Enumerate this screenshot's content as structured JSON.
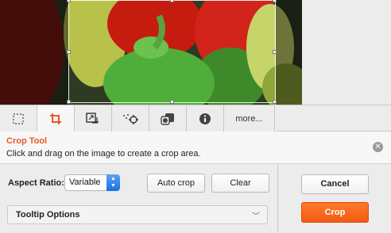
{
  "tabs": [
    {
      "id": "select",
      "icon": "marquee-select-icon",
      "active": false
    },
    {
      "id": "crop",
      "icon": "crop-icon",
      "active": true
    },
    {
      "id": "transform",
      "icon": "resize-rotate-icon",
      "active": false
    },
    {
      "id": "focus",
      "icon": "focus-point-icon",
      "active": false
    },
    {
      "id": "overlay",
      "icon": "overlay-icon",
      "active": false
    },
    {
      "id": "info",
      "icon": "info-icon",
      "active": false
    },
    {
      "id": "more",
      "label": "more..."
    }
  ],
  "banner": {
    "title": "Crop Tool",
    "description": "Click and drag on the image to create a crop area.",
    "close_icon": "close-circle-icon"
  },
  "controls": {
    "aspect_label": "Aspect Ratio:",
    "aspect_value": "Variable",
    "auto_crop_label": "Auto crop",
    "clear_label": "Clear",
    "tooltip_options_label": "Tooltip Options"
  },
  "actions": {
    "cancel_label": "Cancel",
    "crop_label": "Crop"
  },
  "colors": {
    "accent": "#e8572a",
    "crop_button": "#f5641a"
  }
}
